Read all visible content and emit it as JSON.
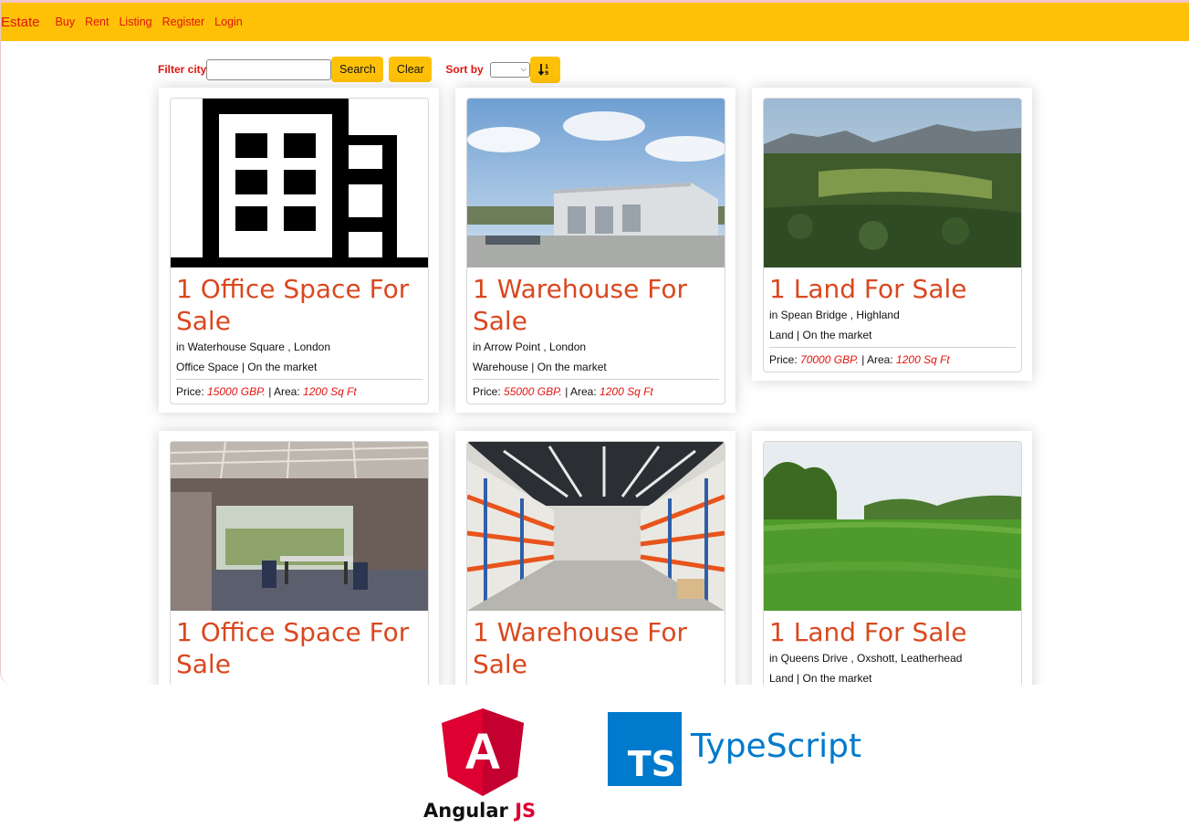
{
  "navbar": {
    "brand": "Estate",
    "links": [
      "Buy",
      "Rent",
      "Listing",
      "Register",
      "Login"
    ]
  },
  "toolbar": {
    "filter_label": "Filter city",
    "filter_value": "",
    "search_label": "Search",
    "clear_label": "Clear",
    "sort_label": "Sort by",
    "sort_value": "",
    "sort_icon": "sort-descending-icon"
  },
  "listings": [
    {
      "title": "1 Office Space For Sale",
      "location": "in Waterhouse Square , London",
      "type_line": "Office Space | On the market",
      "price_label": "Price:",
      "price": "15000 GBP.",
      "area_label": "| Area:",
      "area": "1200 Sq Ft",
      "image": "office-building-icon"
    },
    {
      "title": "1 Warehouse For Sale",
      "location": "in Arrow Point , London",
      "type_line": "Warehouse | On the market",
      "price_label": "Price:",
      "price": "55000 GBP.",
      "area_label": "| Area:",
      "area": "1200 Sq Ft",
      "image": "warehouse-photo"
    },
    {
      "title": "1 Land For Sale",
      "location": "in Spean Bridge , Highland",
      "type_line": "Land | On the market",
      "price_label": "Price:",
      "price": "70000 GBP.",
      "area_label": "| Area:",
      "area": "1200 Sq Ft",
      "image": "highland-land-photo"
    },
    {
      "title": "1 Office Space For Sale",
      "location": "",
      "type_line": "",
      "image": "office-interior-photo"
    },
    {
      "title": "1 Warehouse For Sale",
      "location": "",
      "type_line": "",
      "image": "warehouse-interior-photo"
    },
    {
      "title": "1 Land For Sale",
      "location": "in Queens Drive , Oxshott, Leatherhead",
      "type_line": "Land | On the market",
      "image": "green-field-photo"
    }
  ],
  "logos": {
    "angular_letter": "A",
    "angular_text": "Angular",
    "angular_js": "JS",
    "ts_badge": "TS",
    "ts_text": "TypeScript"
  },
  "colors": {
    "navbar": "#ffc107",
    "nav_text": "#e0140e",
    "title_text": "#d9481f",
    "angular_red": "#dd0031",
    "ts_blue": "#007acc"
  }
}
